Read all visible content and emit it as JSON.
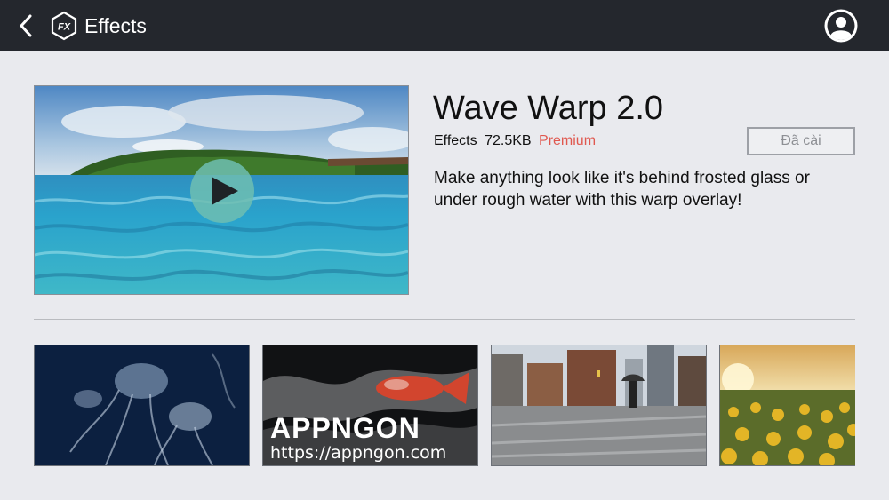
{
  "header": {
    "title": "Effects",
    "logo_text": "FX"
  },
  "effect": {
    "name": "Wave Warp 2.0",
    "category": "Effects",
    "size": "72.5KB",
    "tier": "Premium",
    "install_label": "Đã cài",
    "description": "Make anything look like it's behind frosted glass or under rough water with this warp overlay!"
  },
  "watermark": {
    "brand": "APPNGON",
    "url": "https://appngon.com"
  },
  "colors": {
    "header_bg": "#24272d",
    "page_bg": "#e9eaee",
    "premium": "#e0584f",
    "play_button": "#6ebeb2"
  },
  "icons": {
    "back": "chevron-left-icon",
    "logo": "fx-hexagon-icon",
    "account": "user-circle-icon",
    "play": "play-icon"
  },
  "thumbnails": [
    {
      "name": "jellyfish-thumbnail"
    },
    {
      "name": "koi-fish-thumbnail"
    },
    {
      "name": "rainy-street-thumbnail"
    },
    {
      "name": "sunflower-field-thumbnail"
    }
  ]
}
